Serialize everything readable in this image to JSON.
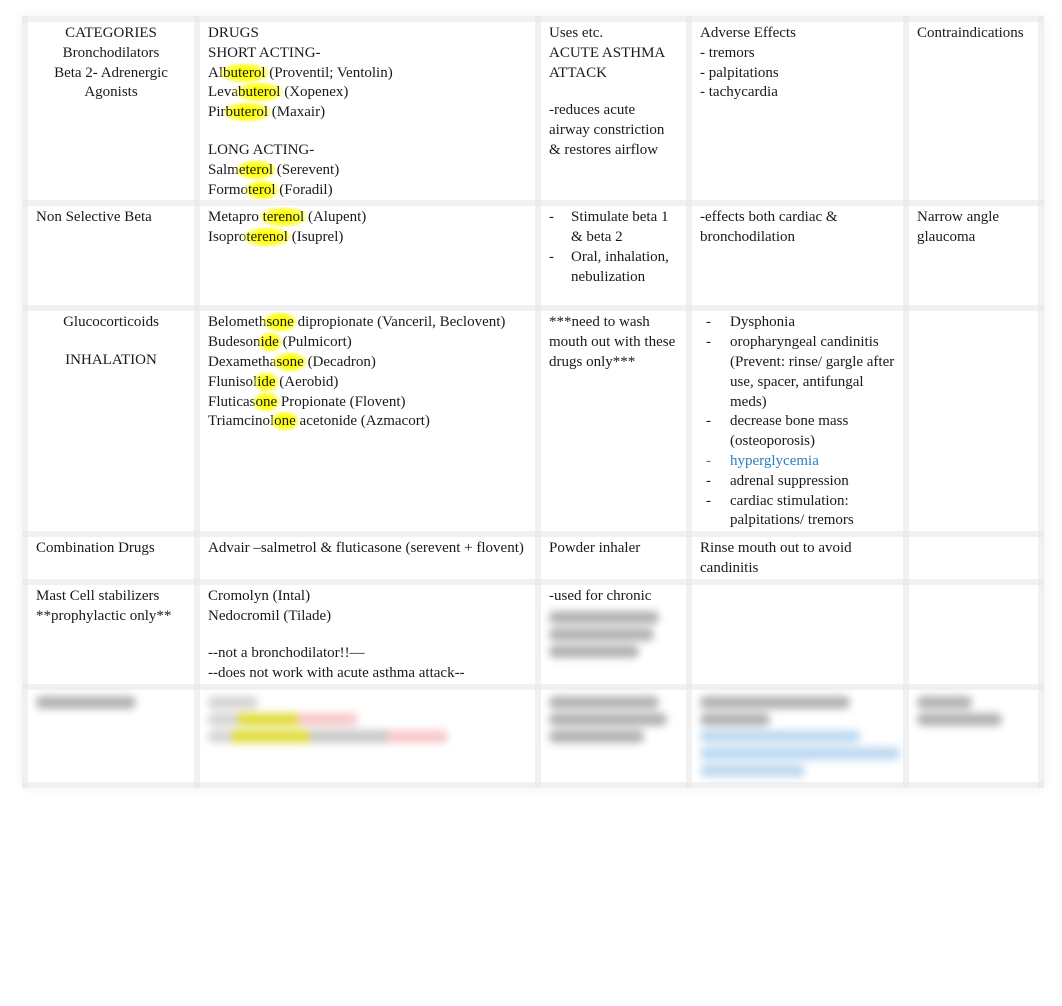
{
  "headers": {
    "categories": "CATEGORIES",
    "drugs": "DRUGS",
    "uses": "Uses etc.",
    "adverse": "Adverse Effects",
    "contra": "Contraindications"
  },
  "colors": {
    "highlight": "#ffff00",
    "link_blue": "#2a7fc1",
    "text": "#1a1a1a"
  },
  "rows": {
    "beta2": {
      "category": [
        "Bronchodilators",
        "Beta 2- Adrenergic",
        "Agonists"
      ],
      "short_label": "SHORT ACTING-",
      "short_drugs": [
        {
          "pre": "Al",
          "hl": "buterol",
          "post": " (Proventil; Ventolin)"
        },
        {
          "pre": "Leva",
          "hl": "buterol",
          "post": " (Xopenex)"
        },
        {
          "pre": "Pir",
          "hl": "buterol",
          "post": " (Maxair)"
        }
      ],
      "long_label": "LONG ACTING-",
      "long_drugs": [
        {
          "pre": "Salm",
          "hl": "eterol",
          "post": " (Serevent)"
        },
        {
          "pre": "Formo",
          "hl": "terol",
          "post": " (Foradil)"
        }
      ],
      "uses": [
        "ACUTE ASTHMA",
        "ATTACK",
        "-reduces acute airway constriction & restores airflow"
      ],
      "adverse": [
        "- tremors",
        "- palpitations",
        "- tachycardia"
      ],
      "contra": ""
    },
    "nonselective": {
      "category": "Non Selective Beta",
      "drugs": [
        {
          "pre": "Metapro ",
          "hl": "terenol",
          "post": " (Alupent)"
        },
        {
          "pre": "Isopro",
          "hl": "terenol",
          "post": " (Isuprel)"
        }
      ],
      "uses": [
        "Stimulate beta 1 & beta 2",
        "Oral, inhalation, nebulization"
      ],
      "adverse": "-effects both cardiac & bronchodilation",
      "contra": "Narrow angle glaucoma"
    },
    "gluco": {
      "category": [
        "Glucocorticoids",
        "INHALATION"
      ],
      "drugs": [
        {
          "pre": "Belometh",
          "hl": "sone",
          "post": " dipropionate (Vanceril, Beclovent)"
        },
        {
          "pre": "Budeson",
          "hl": "ide",
          "post": " (Pulmicort)"
        },
        {
          "pre": "Dexametha",
          "hl": "sone",
          "post": " (Decadron)"
        },
        {
          "pre": "Flunisol",
          "hl": "ide",
          "post": " (Aerobid)"
        },
        {
          "pre": "Fluticas",
          "hl": "one",
          "post": " Propionate (Flovent)"
        },
        {
          "pre": "Triamcinol",
          "hl": "one",
          "post": " acetonide (Azmacort)"
        }
      ],
      "uses": "***need to wash mouth out with these drugs only***",
      "adverse": [
        {
          "text": "Dysphonia",
          "blue": false
        },
        {
          "text": "oropharyngeal candinitis (Prevent: rinse/ gargle after use, spacer, antifungal meds)",
          "blue": false
        },
        {
          "text": "decrease bone mass (osteoporosis)",
          "blue": false
        },
        {
          "text": "hyperglycemia",
          "blue": true
        },
        {
          "text": "adrenal suppression",
          "blue": false
        },
        {
          "text": "cardiac stimulation: palpitations/ tremors",
          "blue": false
        }
      ],
      "contra": ""
    },
    "combo": {
      "category": "Combination Drugs",
      "drugs": "Advair –salmetrol & fluticasone (serevent + flovent)",
      "uses": "Powder inhaler",
      "adverse": "Rinse mouth out to avoid candinitis",
      "contra": ""
    },
    "mast": {
      "category": [
        "Mast Cell stabilizers",
        "**prophylactic only**"
      ],
      "drugs": [
        "Cromolyn (Intal)",
        "Nedocromil (Tilade)",
        "--not a bronchodilator!!—",
        "--does not work with acute asthma attack--"
      ],
      "uses": "-used for chronic",
      "adverse": "",
      "contra": ""
    }
  }
}
